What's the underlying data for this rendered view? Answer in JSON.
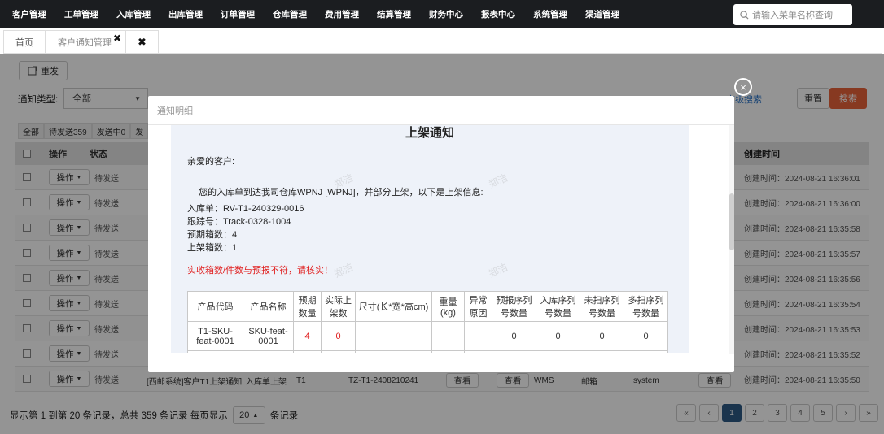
{
  "nav": {
    "items": [
      "客户管理",
      "工单管理",
      "入库管理",
      "出库管理",
      "订单管理",
      "仓库管理",
      "费用管理",
      "结算管理",
      "财务中心",
      "报表中心",
      "系统管理",
      "渠道管理"
    ],
    "search_placeholder": "请输入菜单名称查询"
  },
  "tabs": {
    "home": "首页",
    "active": "客户通知管理",
    "active_close": "✖",
    "close_all": "✖"
  },
  "toolbar": {
    "resend": "重发"
  },
  "filters": {
    "type_label": "通知类型:",
    "type_value": "全部",
    "adv_search": "高级搜索",
    "reset": "重置",
    "search": "搜索"
  },
  "status_tabs": [
    "全部",
    "待发送359",
    "发送中0",
    "发"
  ],
  "grid": {
    "headers": {
      "op": "操作",
      "status": "状态",
      "created": "创建时间"
    },
    "op_label": "操作",
    "rows": [
      {
        "status": "待发送",
        "created": "创建时间：2024-08-21 16:36:01"
      },
      {
        "status": "待发送",
        "created": "创建时间：2024-08-21 16:36:00"
      },
      {
        "status": "待发送",
        "created": "创建时间：2024-08-21 16:35:58"
      },
      {
        "status": "待发送",
        "created": "创建时间：2024-08-21 16:35:57"
      },
      {
        "status": "待发送",
        "created": "创建时间：2024-08-21 16:35:56"
      },
      {
        "status": "待发送",
        "created": "创建时间：2024-08-21 16:35:54"
      },
      {
        "status": "待发送",
        "created": "创建时间：2024-08-21 16:35:53"
      },
      {
        "status": "待发送",
        "created": "创建时间：2024-08-21 16:35:52"
      },
      {
        "status": "待发送",
        "created": "创建时间：2024-08-21 16:35:50"
      }
    ],
    "last_row_extra": {
      "title": "[西邮系统]客户T1上架通知",
      "event": "入库单上架",
      "customer": "T1",
      "no": "TZ-T1-2408210241",
      "view1": "查看",
      "view2": "查看",
      "source": "WMS",
      "channel": "邮箱",
      "creator": "system",
      "view3": "查看"
    }
  },
  "footer": {
    "summary": "显示第 1 到第 20 条记录，总共 359 条记录 每页显示",
    "page_size": "20",
    "suffix": "条记录"
  },
  "pagination": [
    "«",
    "‹",
    "1",
    "2",
    "3",
    "4",
    "5",
    "›",
    "»"
  ],
  "modal": {
    "title": "通知明细",
    "close": "×",
    "notice_title": "上架通知",
    "greeting": "亲爱的客户:",
    "intro": "您的入库单到达我司仓库WPNJ [WPNJ]，并部分上架，以下是上架信息:",
    "inbound_no": "入库单：RV-T1-240329-0016",
    "tracking_no": "跟踪号：Track-0328-1004",
    "expected_boxes": "预期箱数：4",
    "shelved_boxes": "上架箱数：1",
    "warning": "实收箱数/件数与预报不符，请核实！",
    "table_headers": [
      "产品代码",
      "产品名称",
      "预期数量",
      "实际上架数",
      "尺寸(长*宽*高cm)",
      "重量(kg)",
      "异常原因",
      "预报序列号数量",
      "入库序列号数量",
      "未扫序列号数量",
      "多扫序列号数量"
    ],
    "table_row": [
      "T1-SKU-feat-0001",
      "SKU-feat-0001",
      "4",
      "0",
      "",
      "",
      "",
      "0",
      "0",
      "0",
      "0"
    ]
  },
  "watermark": "郑洁"
}
